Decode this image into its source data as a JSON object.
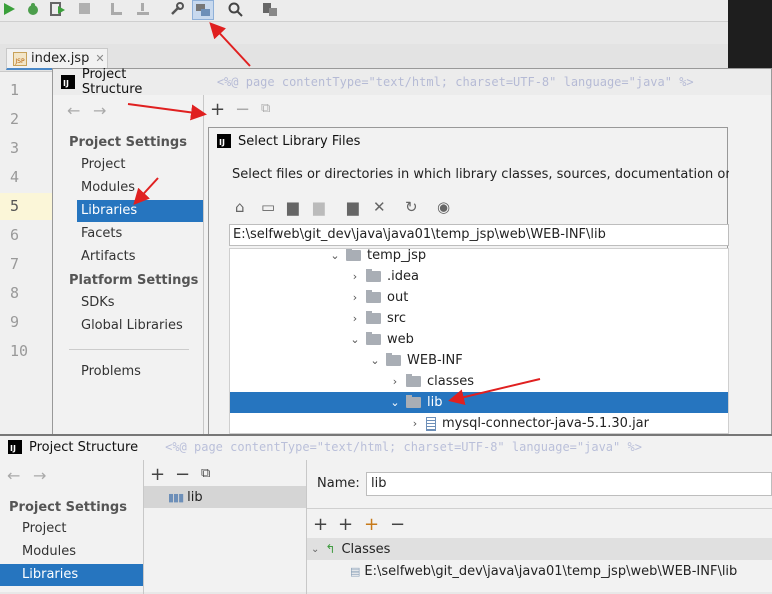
{
  "editor": {
    "tab_label": "index.jsp",
    "tab_badge": "JSP",
    "line_numbers": [
      "1",
      "2",
      "3",
      "4",
      "5",
      "6",
      "7",
      "8",
      "9",
      "10"
    ],
    "code_snippet": "<%@ page contentType=\"text/html; charset=UTF-8\" language=\"java\" %>"
  },
  "project_structure_back": {
    "title": "Project Structure",
    "project_settings_header": "Project Settings",
    "project_settings_items": [
      "Project",
      "Modules",
      "Libraries",
      "Facets",
      "Artifacts"
    ],
    "platform_settings_header": "Platform Settings",
    "platform_settings_items": [
      "SDKs",
      "Global Libraries"
    ],
    "problems": "Problems"
  },
  "select_library": {
    "title": "Select Library Files",
    "description": "Select files or directories in which library classes, sources, documentation or native lib",
    "path": "E:\\selfweb\\git_dev\\java\\java01\\temp_jsp\\web\\WEB-INF\\lib",
    "tree": [
      {
        "label": "temp_jsp",
        "depth": 0,
        "expanded": true
      },
      {
        "label": ".idea",
        "depth": 1,
        "expanded": false
      },
      {
        "label": "out",
        "depth": 1,
        "expanded": false
      },
      {
        "label": "src",
        "depth": 1,
        "expanded": false
      },
      {
        "label": "web",
        "depth": 1,
        "expanded": true
      },
      {
        "label": "WEB-INF",
        "depth": 2,
        "expanded": true
      },
      {
        "label": "classes",
        "depth": 3,
        "expanded": false
      },
      {
        "label": "lib",
        "depth": 3,
        "expanded": true,
        "selected": true
      },
      {
        "label": "mysql-connector-java-5.1.30.jar",
        "depth": 4,
        "expanded": false,
        "jar": true
      }
    ]
  },
  "project_structure_front": {
    "title": "Project Structure",
    "project_settings_header": "Project Settings",
    "items": [
      "Project",
      "Modules",
      "Libraries"
    ],
    "library_name": "lib",
    "name_label": "Name:",
    "name_value": "lib",
    "classes_label": "Classes",
    "classes_path": "E:\\selfweb\\git_dev\\java\\java01\\temp_jsp\\web\\WEB-INF\\lib"
  },
  "colors": {
    "selection": "#2675bf",
    "annotation_arrow": "#e02020"
  }
}
